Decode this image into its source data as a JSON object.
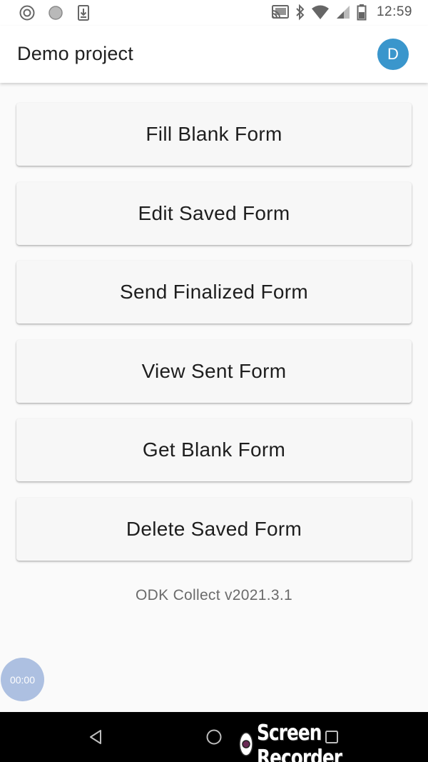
{
  "status_bar": {
    "time": "12:59",
    "left_icons": [
      "record-icon",
      "circle-dot-icon",
      "download-icon"
    ],
    "right_icons": [
      "cast-icon",
      "bluetooth-icon",
      "wifi-icon",
      "signal-icon",
      "battery-icon"
    ]
  },
  "app_bar": {
    "title": "Demo project",
    "avatar_letter": "D",
    "avatar_color": "#3a96cc"
  },
  "main": {
    "buttons": [
      {
        "label": "Fill Blank Form"
      },
      {
        "label": "Edit Saved Form"
      },
      {
        "label": "Send Finalized Form"
      },
      {
        "label": "View Sent Form"
      },
      {
        "label": "Get Blank Form"
      },
      {
        "label": "Delete Saved Form"
      }
    ],
    "version": "ODK Collect v2021.3.1"
  },
  "recorder": {
    "timer": "00:00",
    "watermark": "Screen Recorder"
  },
  "nav_bar": {
    "icons": [
      "back-icon",
      "home-icon",
      "recents-icon"
    ]
  }
}
